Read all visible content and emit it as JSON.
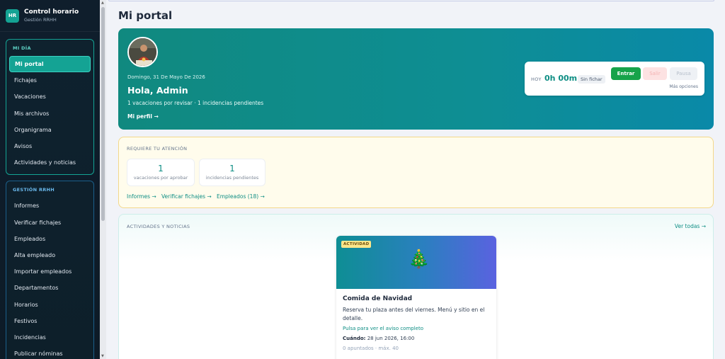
{
  "brand": {
    "logo": "HR",
    "title": "Control horario",
    "subtitle": "Gestión RRHH"
  },
  "sidebar": {
    "groups": [
      {
        "title": "MI DÍA",
        "items": [
          "Mi portal",
          "Fichajes",
          "Vacaciones",
          "Mis archivos",
          "Organigrama",
          "Avisos",
          "Actividades y noticias"
        ],
        "active": "Mi portal"
      },
      {
        "title": "GESTIÓN RRHH",
        "items": [
          "Informes",
          "Verificar fichajes",
          "Empleados",
          "Alta empleado",
          "Importar empleados",
          "Departamentos",
          "Horarios",
          "Festivos",
          "Incidencias",
          "Publicar nóminas"
        ]
      }
    ]
  },
  "page": {
    "title": "Mi portal"
  },
  "hero": {
    "date": "Domingo, 31 De Mayo De 2026",
    "greeting": "Hola, Admin",
    "summary": "1 vacaciones por revisar · 1 incidencias pendientes",
    "profile_link": "Mi perfil →"
  },
  "clock": {
    "today_label": "HOY",
    "time": "0h 00m",
    "status": "Sin fichar",
    "enter": "Entrar",
    "exit": "Salir",
    "pause": "Pausa",
    "more": "Más opciones"
  },
  "attention": {
    "title": "REQUIERE TU ATENCIÓN",
    "stats": [
      {
        "value": "1",
        "label": "vacaciones por aprobar"
      },
      {
        "value": "1",
        "label": "incidencias pendientes"
      }
    ],
    "links": [
      "Informes →",
      "Verificar fichajes →",
      "Empleados (18) →"
    ]
  },
  "news": {
    "title": "ACTIVIDADES Y NOTICIAS",
    "see_all": "Ver todas →",
    "card": {
      "badge": "ACTIVIDAD",
      "emoji": "🎄",
      "title": "Comida de Navidad",
      "text": "Reserva tu plaza antes del viernes. Menú y sitio en el detalle.",
      "link": "Pulsa para ver el aviso completo",
      "when_label": "Cuándo:",
      "when_value": "28 jun 2026, 16:00",
      "count": "0 apuntados · máx. 40"
    }
  },
  "colors": {
    "accent": "#14a394",
    "teal_text": "#0e8e84",
    "enter_button": "#16a34a",
    "sidebar_bg": "#0f1e2c"
  }
}
